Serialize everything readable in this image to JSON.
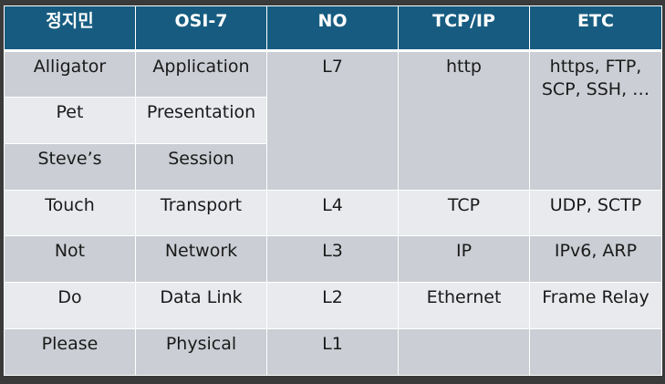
{
  "header": {
    "col1": "정지민",
    "col2": "OSI-7",
    "col3": "NO",
    "col4": "TCP/IP",
    "col5": "ETC"
  },
  "rows": [
    {
      "mnemonic": "Alligator",
      "osi": "Application",
      "no": "L7",
      "tcpip": "http",
      "etc": "https, FTP, SCP, SSH, …"
    },
    {
      "mnemonic": "Pet",
      "osi": "Presentation"
    },
    {
      "mnemonic": "Steve’s",
      "osi": "Session"
    },
    {
      "mnemonic": "Touch",
      "osi": "Transport",
      "no": "L4",
      "tcpip": "TCP",
      "etc": "UDP, SCTP"
    },
    {
      "mnemonic": "Not",
      "osi": "Network",
      "no": "L3",
      "tcpip": "IP",
      "etc": "IPv6, ARP"
    },
    {
      "mnemonic": "Do",
      "osi": "Data Link",
      "no": "L2",
      "tcpip": "Ethernet",
      "etc": "Frame Relay"
    },
    {
      "mnemonic": "Please",
      "osi": "Physical",
      "no": "L1",
      "tcpip": "",
      "etc": ""
    }
  ],
  "colors": {
    "header_bg": "#175c80",
    "row_dark": "#cbced4",
    "row_light": "#e8eaed",
    "frame_bg": "#3a3a3a"
  }
}
